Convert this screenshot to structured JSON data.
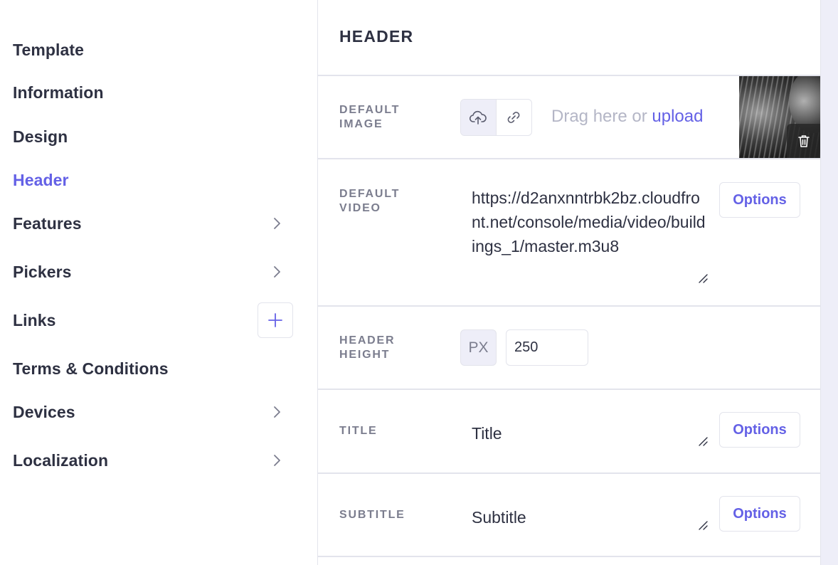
{
  "sidebar": {
    "items": [
      {
        "label": "Template"
      },
      {
        "label": "Information"
      },
      {
        "label": "Design"
      },
      {
        "label": "Header",
        "active": true
      },
      {
        "label": "Features",
        "icon": "chevron-right-icon"
      },
      {
        "label": "Pickers",
        "icon": "chevron-right-icon"
      },
      {
        "label": "Links",
        "icon": "plus-icon"
      },
      {
        "label": "Terms & Conditions"
      },
      {
        "label": "Devices",
        "icon": "chevron-right-icon"
      },
      {
        "label": "Localization",
        "icon": "chevron-right-icon"
      }
    ]
  },
  "panel": {
    "title": "HEADER",
    "default_image": {
      "label_line1": "DEFAULT",
      "label_line2": "IMAGE",
      "drag_text": "Drag here or ",
      "upload_link": "upload",
      "upload_icon": "cloud-upload-icon",
      "link_icon": "link-icon",
      "delete_icon": "trash-icon"
    },
    "default_video": {
      "label_line1": "DEFAULT",
      "label_line2": "VIDEO",
      "value": "https://d2anxnntrbk2bz.cloudfront.net/console/media/video/buildings_1/master.m3u8",
      "options_label": "Options"
    },
    "header_height": {
      "label_line1": "HEADER",
      "label_line2": "HEIGHT",
      "unit": "PX",
      "value": "250"
    },
    "title_field": {
      "label": "TITLE",
      "value": "Title",
      "options_label": "Options"
    },
    "subtitle_field": {
      "label": "SUBTITLE",
      "value": "Subtitle",
      "options_label": "Options"
    }
  },
  "colors": {
    "accent": "#6461e6",
    "text": "#2e3142",
    "muted": "#7b7d8e",
    "border": "#e3e4ec"
  }
}
